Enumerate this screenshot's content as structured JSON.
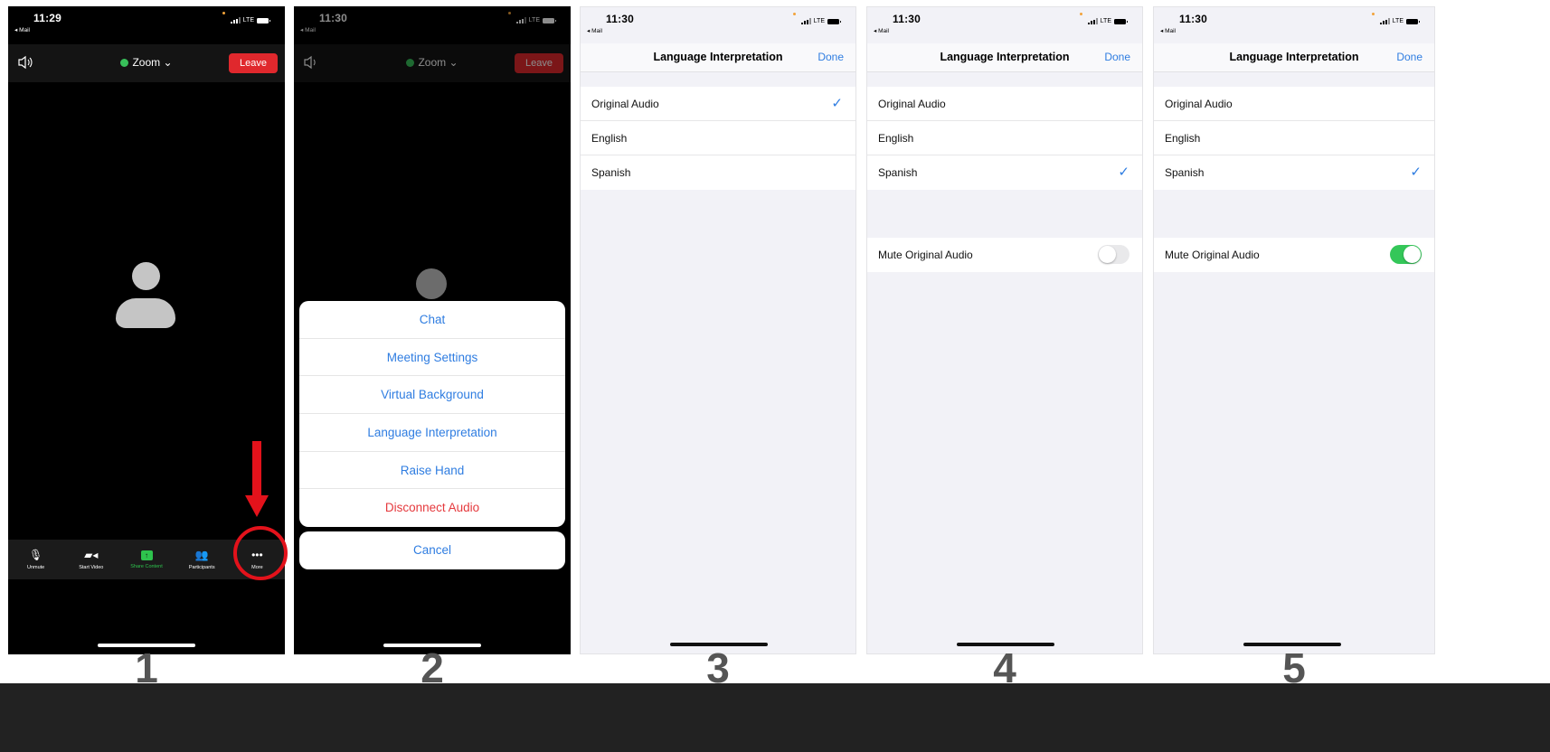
{
  "colors": {
    "leave": "#e0282d",
    "link": "#2f7de1",
    "danger": "#e5393d",
    "toggle_on": "#34c759",
    "annotation": "#e3121b"
  },
  "phone1": {
    "time": "11:29",
    "back": "◂ Mail",
    "network": "LTE",
    "meeting_name": "Zoom",
    "leave_label": "Leave",
    "toolbar": [
      {
        "icon": "mic-muted-icon",
        "label": "Unmute"
      },
      {
        "icon": "video-off-icon",
        "label": "Start Video"
      },
      {
        "icon": "share-icon",
        "label": "Share Content"
      },
      {
        "icon": "participants-icon",
        "label": "Participants"
      },
      {
        "icon": "more-icon",
        "label": "More"
      }
    ]
  },
  "phone2": {
    "time": "11:30",
    "back": "◂ Mail",
    "network": "LTE",
    "meeting_name": "Zoom",
    "leave_label": "Leave",
    "menu": [
      "Chat",
      "Meeting Settings",
      "Virtual Background",
      "Language Interpretation",
      "Raise Hand",
      "Disconnect Audio"
    ],
    "cancel_label": "Cancel"
  },
  "language_screen": {
    "time": "11:30",
    "back": "◂ Mail",
    "network": "LTE",
    "title": "Language Interpretation",
    "done_label": "Done",
    "options": [
      "Original Audio",
      "English",
      "Spanish"
    ],
    "mute_label": "Mute Original Audio"
  },
  "phone3": {
    "selected": "Original Audio",
    "mute_visible": false
  },
  "phone4": {
    "selected": "Spanish",
    "mute_visible": true,
    "mute_on": false
  },
  "phone5": {
    "selected": "Spanish",
    "mute_visible": true,
    "mute_on": true
  },
  "steps": [
    "1",
    "2",
    "3",
    "4",
    "5"
  ]
}
